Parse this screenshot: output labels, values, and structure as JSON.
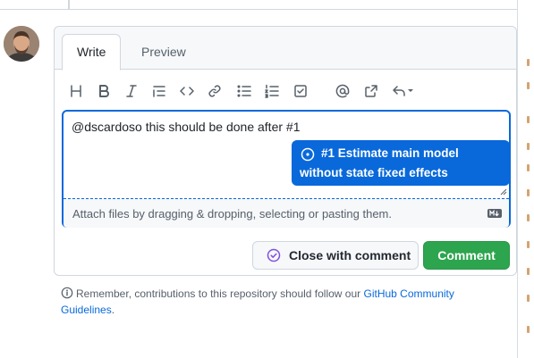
{
  "tabs": {
    "write": "Write",
    "preview": "Preview"
  },
  "toolbar": {
    "icons": [
      "heading-icon",
      "bold-icon",
      "italic-icon",
      "quote-icon",
      "code-icon",
      "link-icon",
      "unordered-list-icon",
      "ordered-list-icon",
      "task-list-icon",
      "mention-icon",
      "cross-reference-icon",
      "saved-replies-icon"
    ]
  },
  "editor": {
    "value": "@dscardoso this should be done after #1",
    "attach_hint": "Attach files by dragging & dropping, selecting or pasting them."
  },
  "suggestion": {
    "line1": "#1 Estimate main model",
    "line2": "without state fixed effects"
  },
  "actions": {
    "close_label": "Close with comment",
    "comment_label": "Comment"
  },
  "footnote": {
    "prefix": "Remember, contributions to this repository should follow our ",
    "link": "GitHub Community Guidelines",
    "suffix": "."
  },
  "colors": {
    "accent": "#0969da",
    "primary_button": "#2da44e",
    "closed_icon": "#8250df"
  }
}
